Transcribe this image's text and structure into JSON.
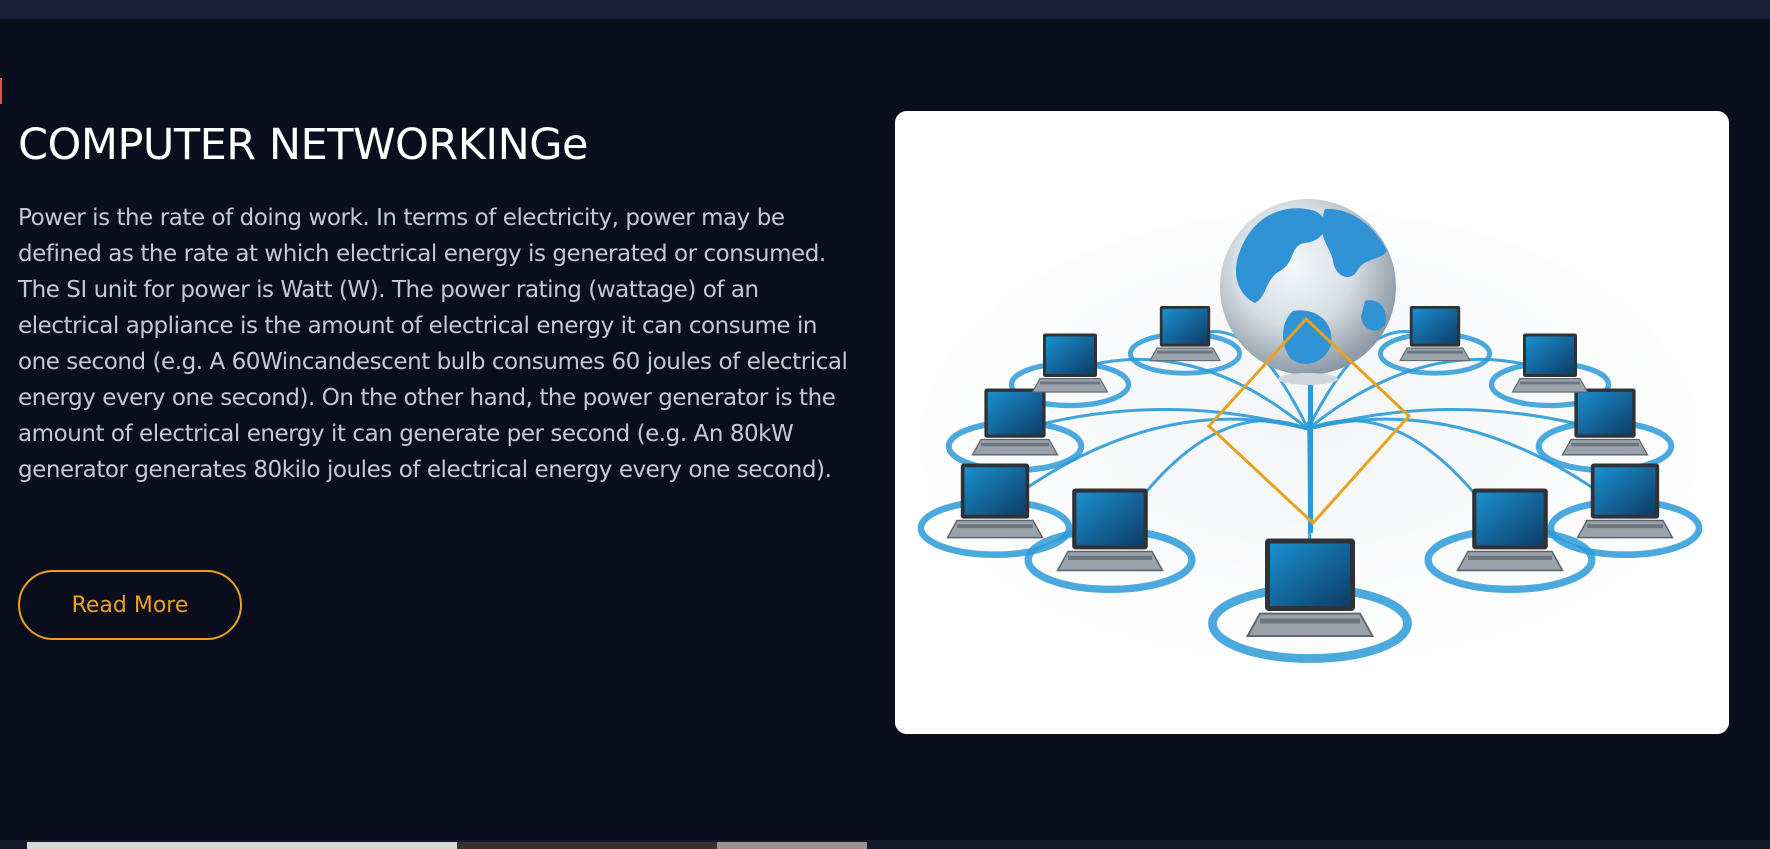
{
  "header": {
    "bar_color": "#1a1f38"
  },
  "section": {
    "title": "COMPUTER NETWORKINGe",
    "body": "Power is the rate of doing work. In terms of electricity, power may be defined as the rate at which electrical energy is generated or consumed. The SI unit for power is Watt (W). The power rating (wattage) of an electrical appliance is the amount of electrical energy it can consume in one second (e.g. A 60Wincandescent bulb consumes 60 joules of electrical energy every one second). On the other hand, the power generator is the amount of electrical energy it can generate per second (e.g. An 80kW generator generates 80kilo joules of electrical energy every one second).",
    "button_label": "Read More"
  },
  "illustration": {
    "description_icon": "network-globe-laptops-illustration",
    "overlay_icon": "diamond-outline-icon"
  },
  "colors": {
    "background": "#0b0f1d",
    "accent": "#e7a21f",
    "title": "#ffffff",
    "body_text": "#c6c8d1",
    "network_blue": "#2b9ad8"
  }
}
